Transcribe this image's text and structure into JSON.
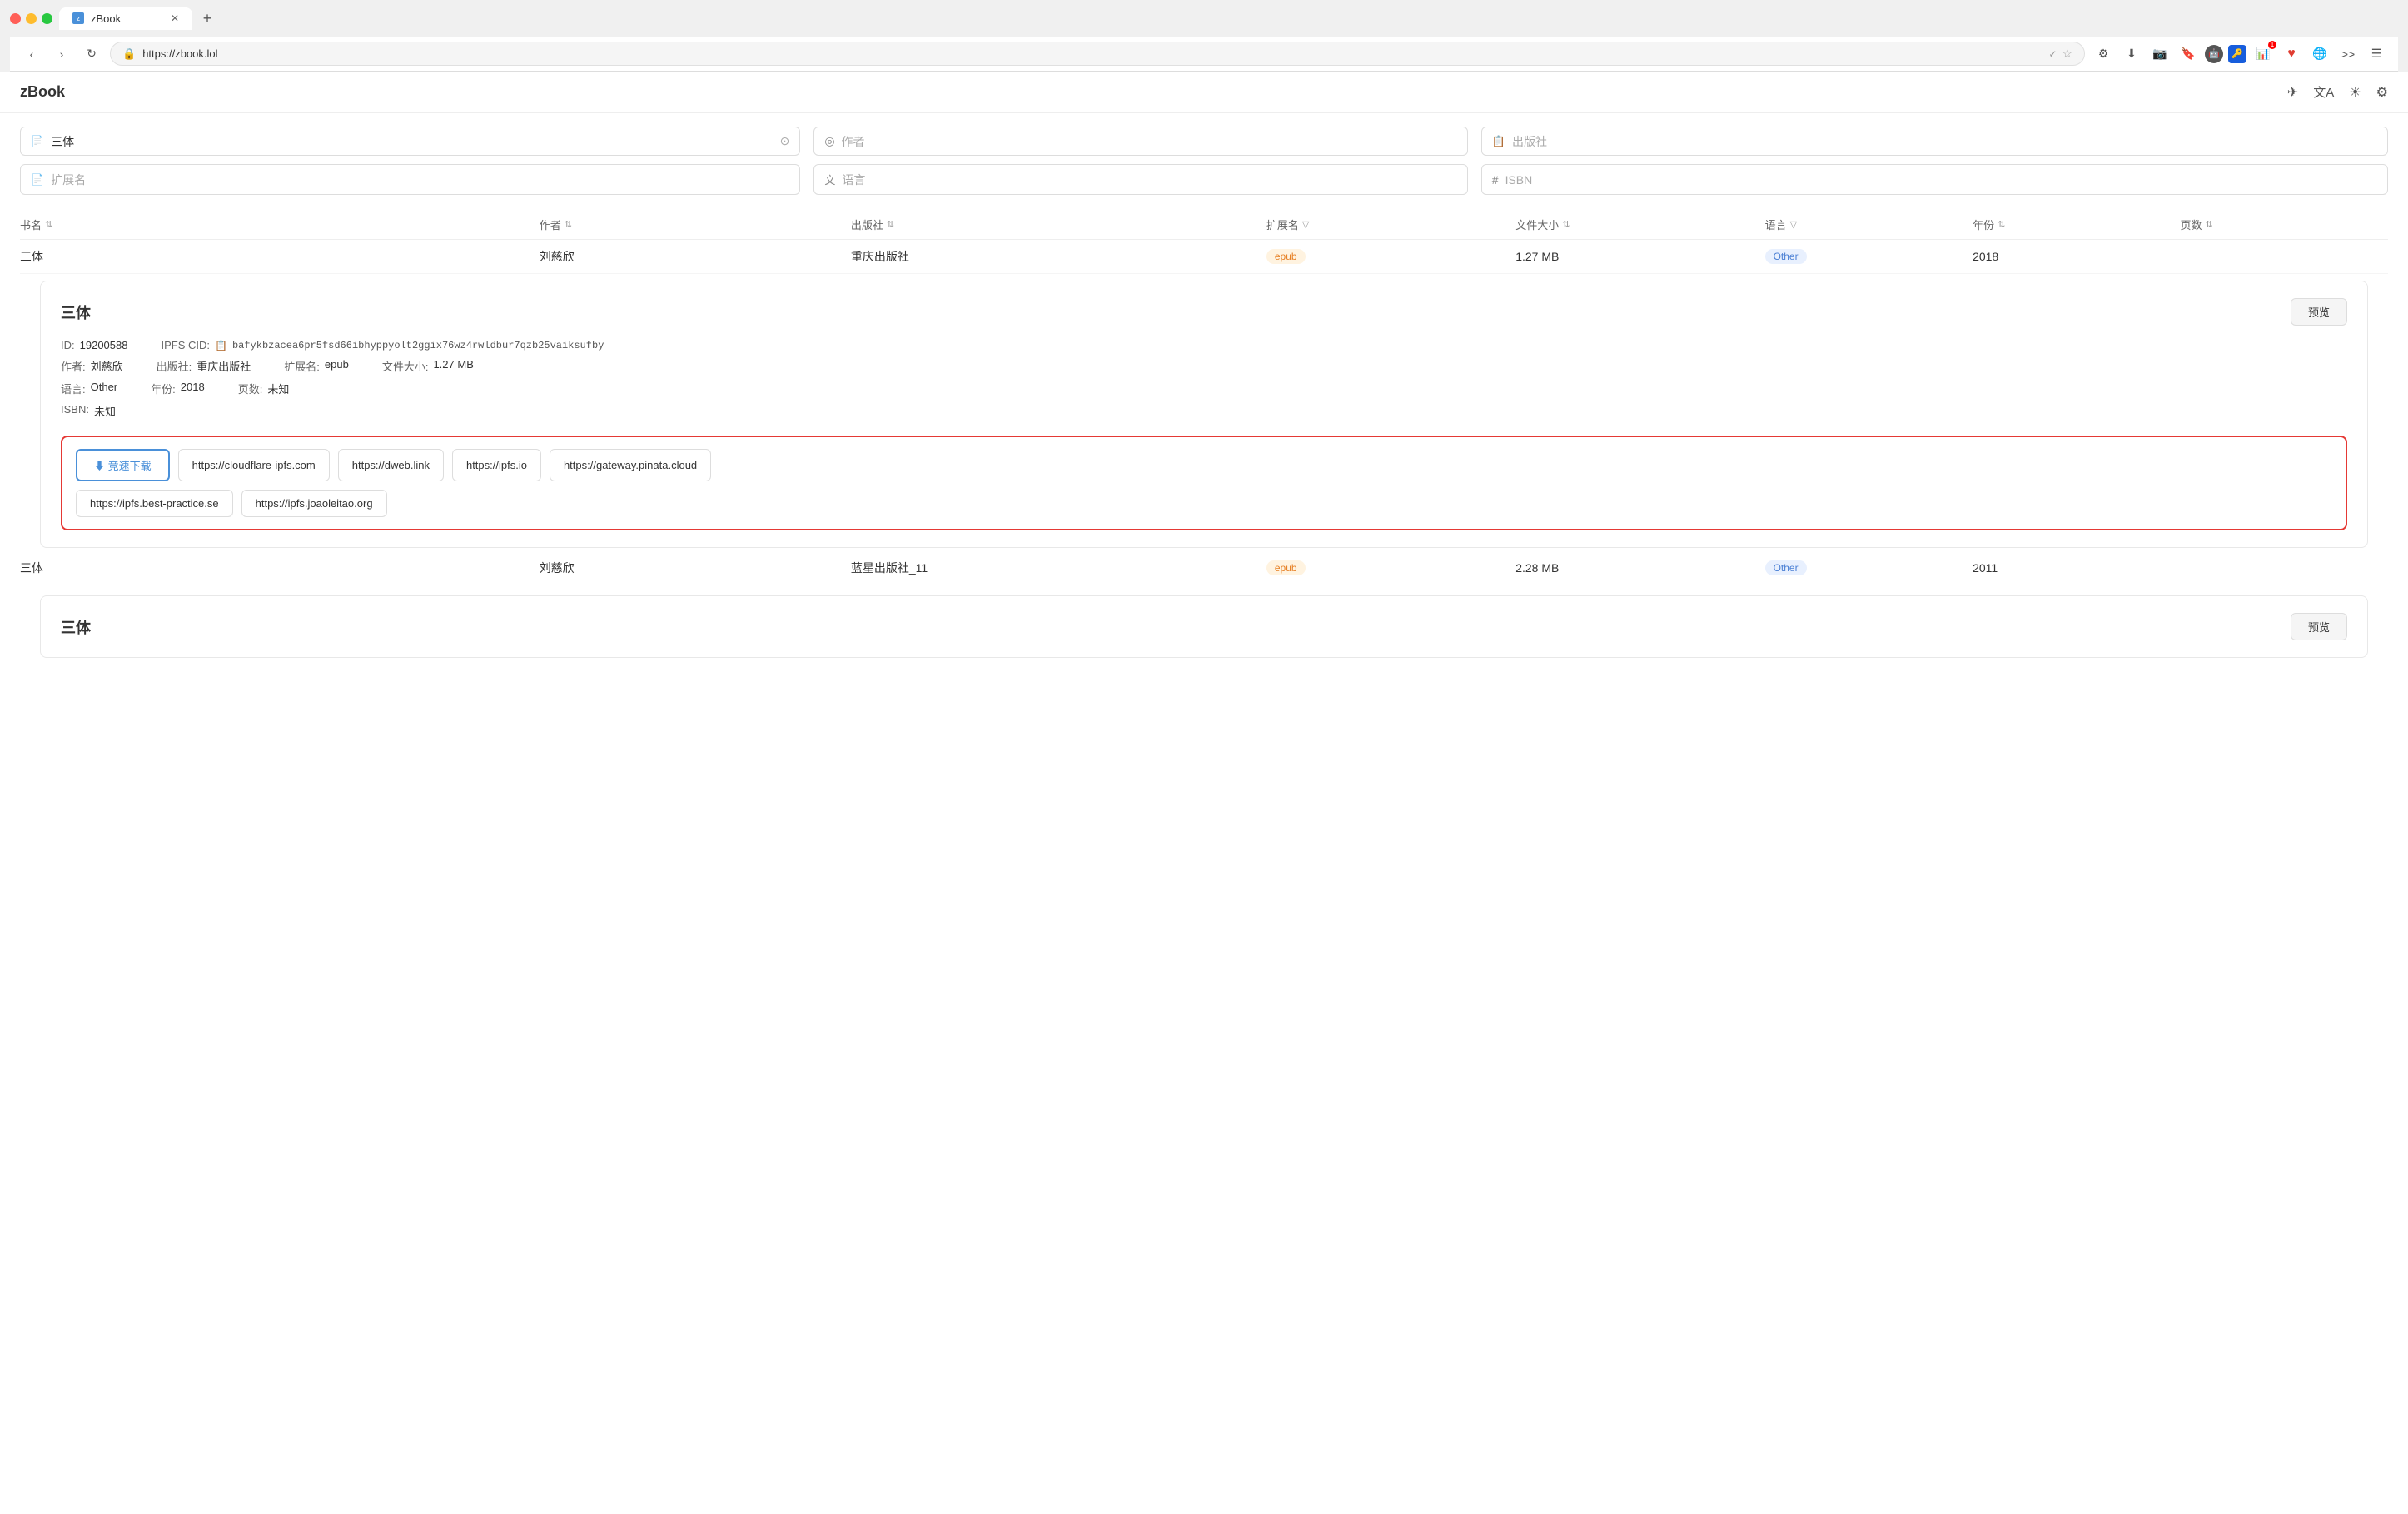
{
  "browser": {
    "url": "https://zbook.lol",
    "tab_title": "zBook",
    "tab_favicon": "z"
  },
  "app": {
    "logo": "zBook",
    "icons": [
      "send-icon",
      "translate-icon",
      "brightness-icon",
      "settings-icon"
    ]
  },
  "search": {
    "book_placeholder": "三体",
    "book_icon": "📄",
    "author_placeholder": "作者",
    "author_icon": "◎",
    "publisher_placeholder": "出版社",
    "publisher_icon": "📋",
    "ext_placeholder": "扩展名",
    "ext_icon": "📄",
    "lang_placeholder": "语言",
    "lang_icon": "🈳",
    "isbn_placeholder": "ISBN",
    "isbn_icon": "#"
  },
  "table": {
    "headers": {
      "title": "书名",
      "author": "作者",
      "publisher": "出版社",
      "ext": "扩展名",
      "size": "文件大小",
      "lang": "语言",
      "year": "年份",
      "pages": "页数"
    },
    "rows": [
      {
        "title": "三体",
        "author": "刘慈欣",
        "publisher": "重庆出版社",
        "ext": "epub",
        "size": "1.27 MB",
        "lang": "Other",
        "year": "2018",
        "pages": ""
      },
      {
        "title": "三体",
        "author": "刘慈欣",
        "publisher": "蓝星出版社_11",
        "ext": "epub",
        "size": "2.28 MB",
        "lang": "Other",
        "year": "2011",
        "pages": ""
      }
    ]
  },
  "detail_panel": {
    "title": "三体",
    "preview_btn": "预览",
    "id": "ID: 19200588",
    "id_label": "ID:",
    "id_value": "19200588",
    "ipfs_cid_label": "IPFS CID:",
    "ipfs_cid_value": "bafykbzacea6pr5fsd66ibhyppyolt2ggix76wz4rwldbur7qzb25vaiksufby",
    "author_label": "作者:",
    "author_value": "刘慈欣",
    "publisher_label": "出版社:",
    "publisher_value": "重庆出版社",
    "ext_label": "扩展名:",
    "ext_value": "epub",
    "size_label": "文件大小:",
    "size_value": "1.27 MB",
    "lang_label": "语言:",
    "lang_value": "Other",
    "year_label": "年份:",
    "year_value": "2018",
    "pages_label": "页数:",
    "pages_value": "未知",
    "isbn_label": "ISBN:",
    "isbn_value": "未知"
  },
  "download": {
    "primary_btn": "⬇ 竞速下载",
    "links": [
      "https://cloudflare-ipfs.com",
      "https://dweb.link",
      "https://ipfs.io",
      "https://gateway.pinata.cloud",
      "https://ipfs.best-practice.se",
      "https://ipfs.joaoleitao.org"
    ]
  },
  "second_panel": {
    "title": "三体",
    "preview_btn": "预览"
  }
}
